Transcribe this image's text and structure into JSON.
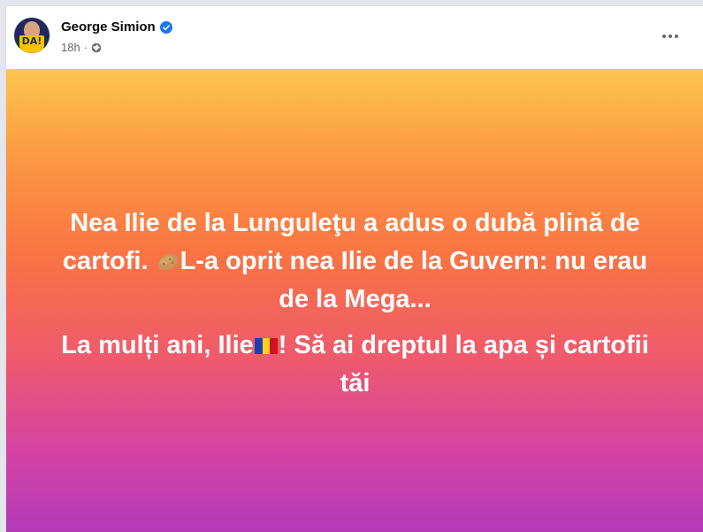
{
  "post": {
    "author": {
      "name": "George Simion",
      "verified": true,
      "avatar_badge_text": "DA!"
    },
    "time": "18h",
    "audience_icon": "globe-icon",
    "more_icon": "more-options-icon",
    "status": {
      "paragraph_1_a": "Nea Ilie de la Lunguleţu a adus o dubă plină de cartofi. ",
      "paragraph_1_emoji": "potato-emoji",
      "paragraph_1_b": "L-a oprit nea Ilie de la Guvern: nu erau de la Mega...",
      "paragraph_2_a": "La mulți ani, Ilie",
      "paragraph_2_emoji": "romania-flag-emoji",
      "paragraph_2_b": "! Să ai dreptul la apa și cartofii tăi"
    }
  },
  "colors": {
    "gradient_top": "#fdc64e",
    "gradient_middle": "#fa7443",
    "gradient_bottom": "#b43ab8",
    "verified_blue": "#1877f2",
    "text_secondary": "#65676b"
  }
}
